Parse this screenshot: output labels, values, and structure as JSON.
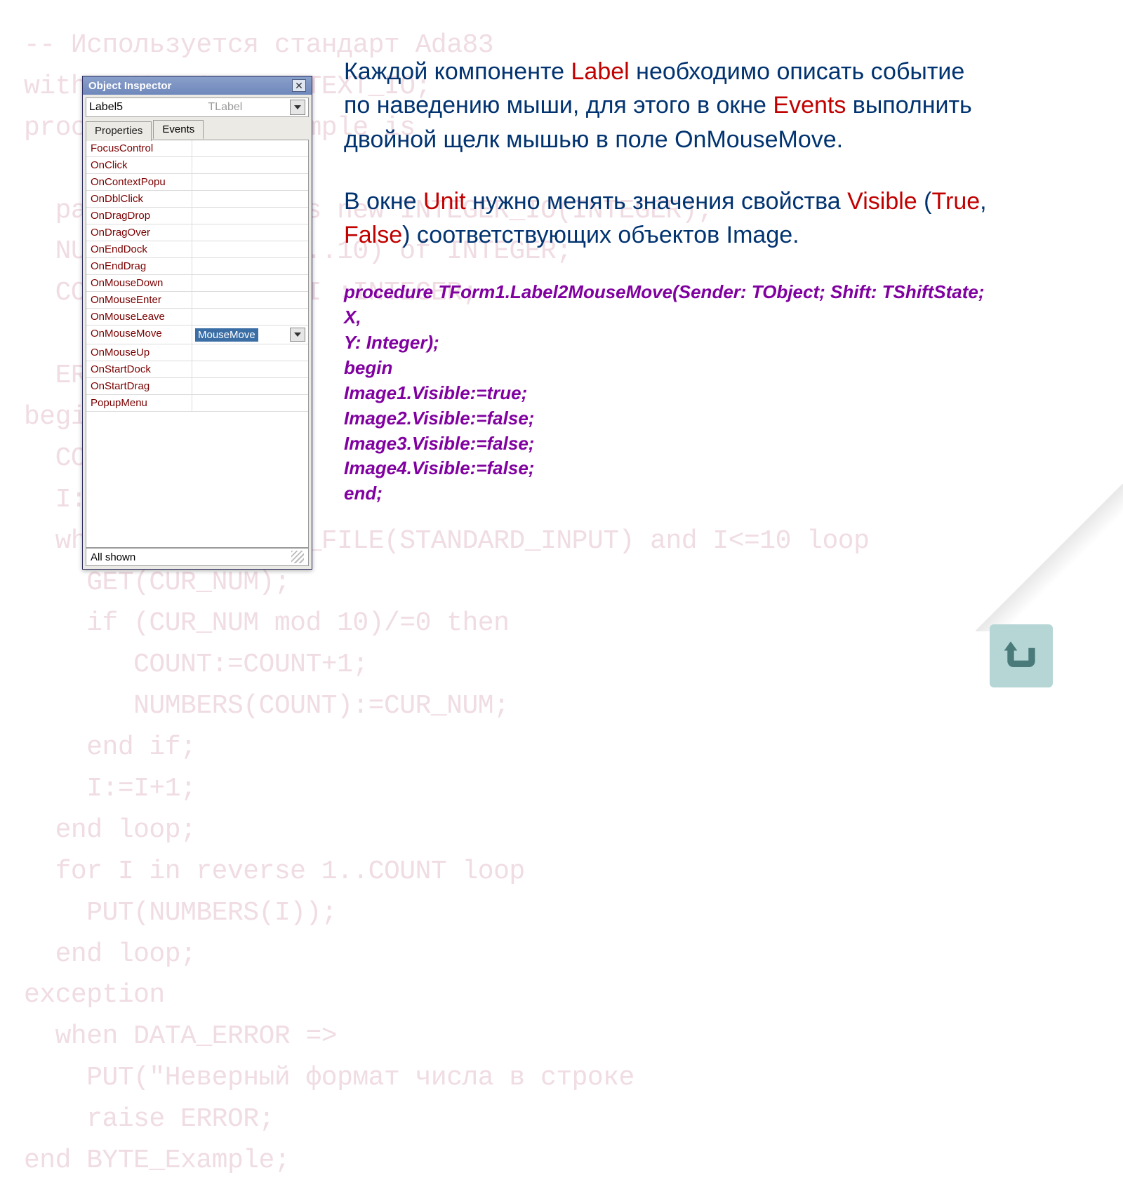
{
  "background_code": "-- Используется стандарт Ada83\nwith TEXT_IO; use TEXT_IO;\nprocedure BYTE_Example is\n\n  package INT_IO is new INTEGER_IO(INTEGER);\n  NUMBERS:array (1..10) of INTEGER;\n  COUNT, CUR_NUM, I :INTEGER;\n\n  ERROR:exception;\nbegin\n  COUNT:=0;\n  I:=1;\n  while not END_OF_FILE(STANDARD_INPUT) and I<=10 loop\n    GET(CUR_NUM);\n    if (CUR_NUM mod 10)/=0 then\n       COUNT:=COUNT+1;\n       NUMBERS(COUNT):=CUR_NUM;\n    end if;\n    I:=I+1;\n  end loop;\n  for I in reverse 1..COUNT loop\n    PUT(NUMBERS(I));\n  end loop;\nexception\n  when DATA_ERROR =>\n    PUT(\"Неверный формат числа в строке\n    raise ERROR;\nend BYTE_Example;",
  "inspector": {
    "title": "Object Inspector",
    "combo": {
      "name": "Label5",
      "type": "TLabel"
    },
    "tabs": {
      "properties": "Properties",
      "events": "Events"
    },
    "events": [
      "FocusControl",
      "OnClick",
      "OnContextPopu",
      "OnDblClick",
      "OnDragDrop",
      "OnDragOver",
      "OnEndDock",
      "OnEndDrag",
      "OnMouseDown",
      "OnMouseEnter",
      "OnMouseLeave",
      "OnMouseMove",
      "OnMouseUp",
      "OnStartDock",
      "OnStartDrag",
      "PopupMenu"
    ],
    "selected_index": 11,
    "selected_value": "MouseMove",
    "status": "All shown"
  },
  "para1": {
    "t1": "Каждой компоненте ",
    "label": "Label",
    "t2": " необходимо описать событие по наведению мыши, для этого в окне ",
    "events": "Events",
    "t3": " выполнить двойной щелк мышью в поле OnMouseMove."
  },
  "para2": {
    "t1": "В окне ",
    "unit": "Unit",
    "t2": " нужно менять значения свойства ",
    "visible": "Visible",
    "t3": " (",
    "true": "True",
    "t4": ", ",
    "false": "False",
    "t5": ") соответствующих объектов Image."
  },
  "code": {
    "l1": "procedure TForm1.Label2MouseMove(Sender: TObject; Shift: TShiftState; X,",
    "l2": "  Y: Integer);",
    "l3": "begin",
    "l4": "   Image1.Visible:=true;",
    "l5": "   Image2.Visible:=false;",
    "l6": "   Image3.Visible:=false;",
    "l7": "   Image4.Visible:=false;",
    "l8": "end;"
  }
}
